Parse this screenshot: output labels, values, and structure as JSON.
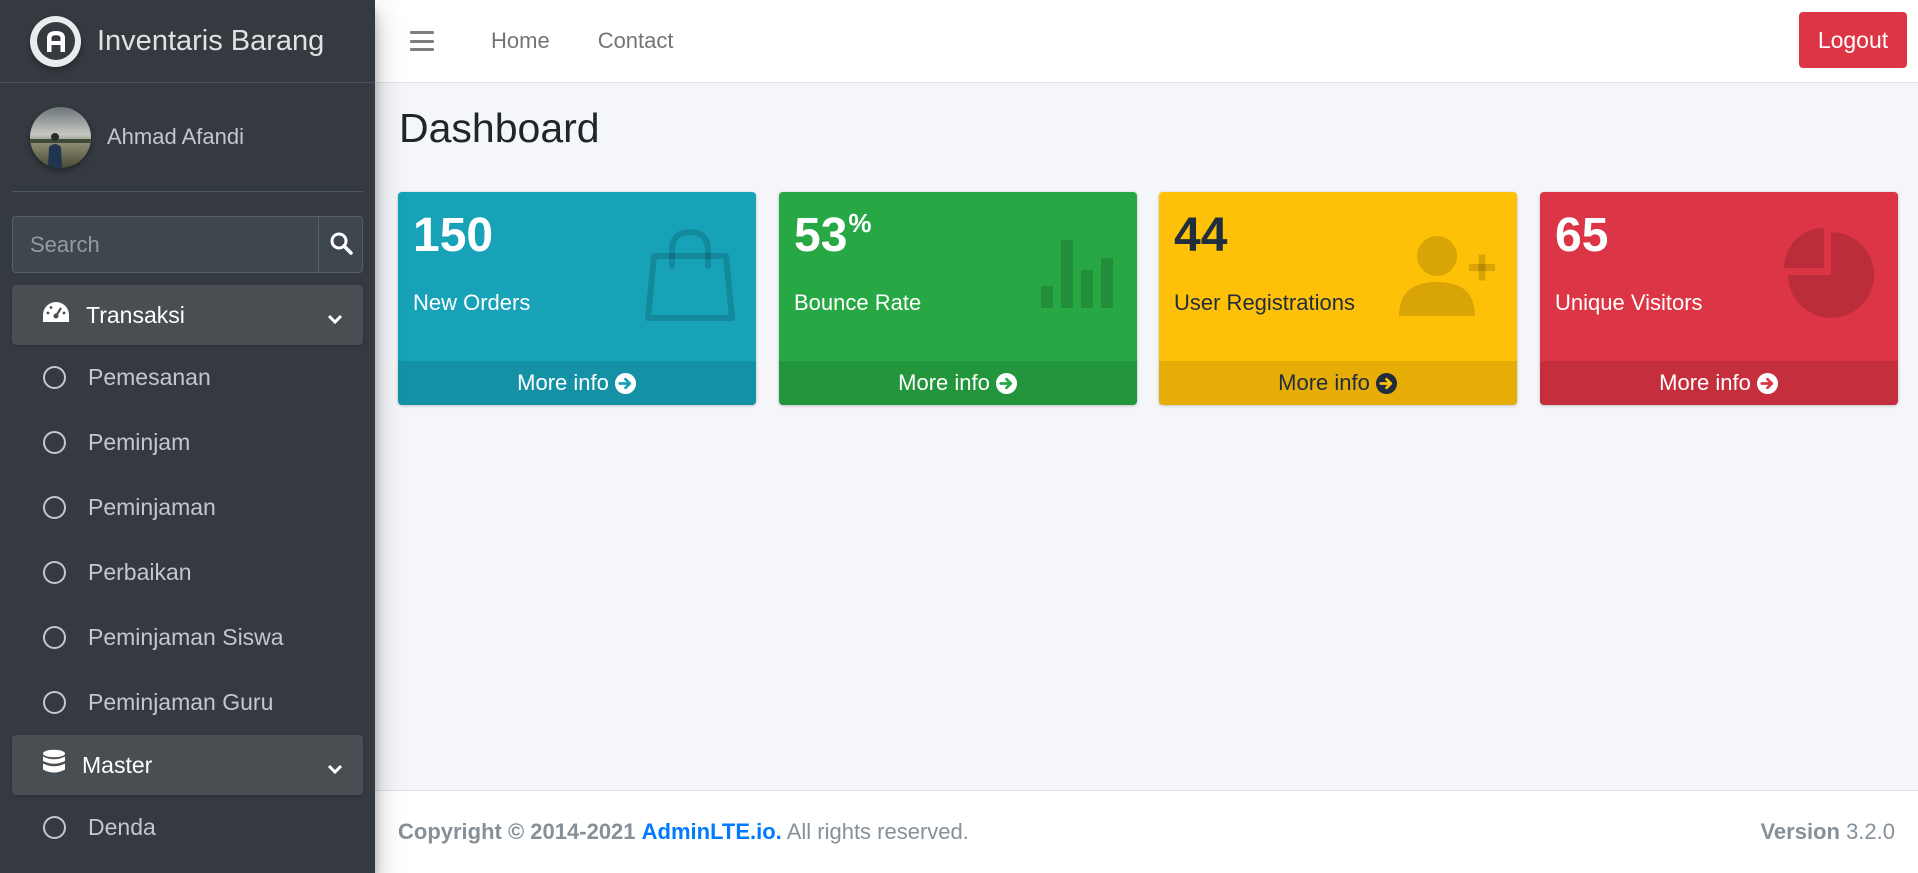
{
  "brand": {
    "title": "Inventaris Barang",
    "logo_letter": "A"
  },
  "user": {
    "name": "Ahmad Afandi"
  },
  "search": {
    "placeholder": "Search"
  },
  "sidebar": {
    "sections": [
      {
        "label": "Transaksi",
        "icon": "tachometer-icon",
        "items": [
          "Pemesanan",
          "Peminjam",
          "Peminjaman",
          "Perbaikan",
          "Peminjaman Siswa",
          "Peminjaman Guru"
        ]
      },
      {
        "label": "Master",
        "icon": "database-icon",
        "items": [
          "Denda"
        ]
      }
    ]
  },
  "topnav": {
    "home": "Home",
    "contact": "Contact",
    "logout": "Logout"
  },
  "page": {
    "title": "Dashboard"
  },
  "boxes": [
    {
      "value": "150",
      "suffix": "",
      "label": "New Orders",
      "more": "More info",
      "icon": "shopping-bag-icon",
      "color": "#17a2b8"
    },
    {
      "value": "53",
      "suffix": "%",
      "label": "Bounce Rate",
      "more": "More info",
      "icon": "bar-chart-icon",
      "color": "#28a745"
    },
    {
      "value": "44",
      "suffix": "",
      "label": "User Registrations",
      "more": "More info",
      "icon": "user-plus-icon",
      "color": "#ffc107"
    },
    {
      "value": "65",
      "suffix": "",
      "label": "Unique Visitors",
      "more": "More info",
      "icon": "pie-chart-icon",
      "color": "#dc3545"
    }
  ],
  "footer": {
    "copyright": "Copyright © 2014-2021",
    "brand": "AdminLTE.io.",
    "rights": "All rights reserved.",
    "version_label": "Version",
    "version": "3.2.0"
  }
}
